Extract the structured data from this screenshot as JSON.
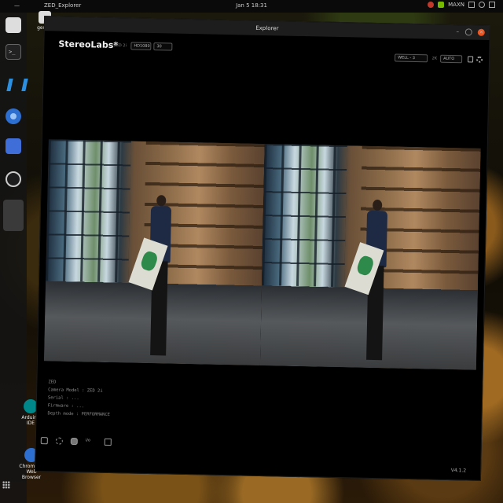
{
  "top_bar": {
    "activities": "—",
    "app_name": "ZED_Explorer",
    "clock": "Jan 5  18:31",
    "tray_label": "MAXN"
  },
  "dock": {
    "items": [
      "files",
      "terminal",
      "vscode",
      "chromium",
      "docs",
      "obs",
      "active-app"
    ]
  },
  "desktop": {
    "icons": [
      {
        "label": "gerbot"
      },
      {
        "label": "Arduino IDE"
      },
      {
        "label": "Chromium Web Browser"
      }
    ]
  },
  "window": {
    "title": "Explorer",
    "minimize_glyph": "–",
    "close_glyph": "×"
  },
  "toolbar": {
    "brand": "StereoLabs*",
    "camera_label": "ZED 2i",
    "resolution": "HD1080",
    "fps": "30",
    "view_mode": "WELL - 3",
    "depth_label": "2K",
    "depth_value": "AUTO"
  },
  "log": {
    "lines": [
      "ZED",
      "Camera Model : ZED 2i",
      "Serial : ...",
      "Firmware : ...",
      "Depth mode : PERFORMANCE"
    ]
  },
  "bottom_toolbar": {
    "info_label": "i/o"
  },
  "status": {
    "version": "V4.1.2"
  }
}
